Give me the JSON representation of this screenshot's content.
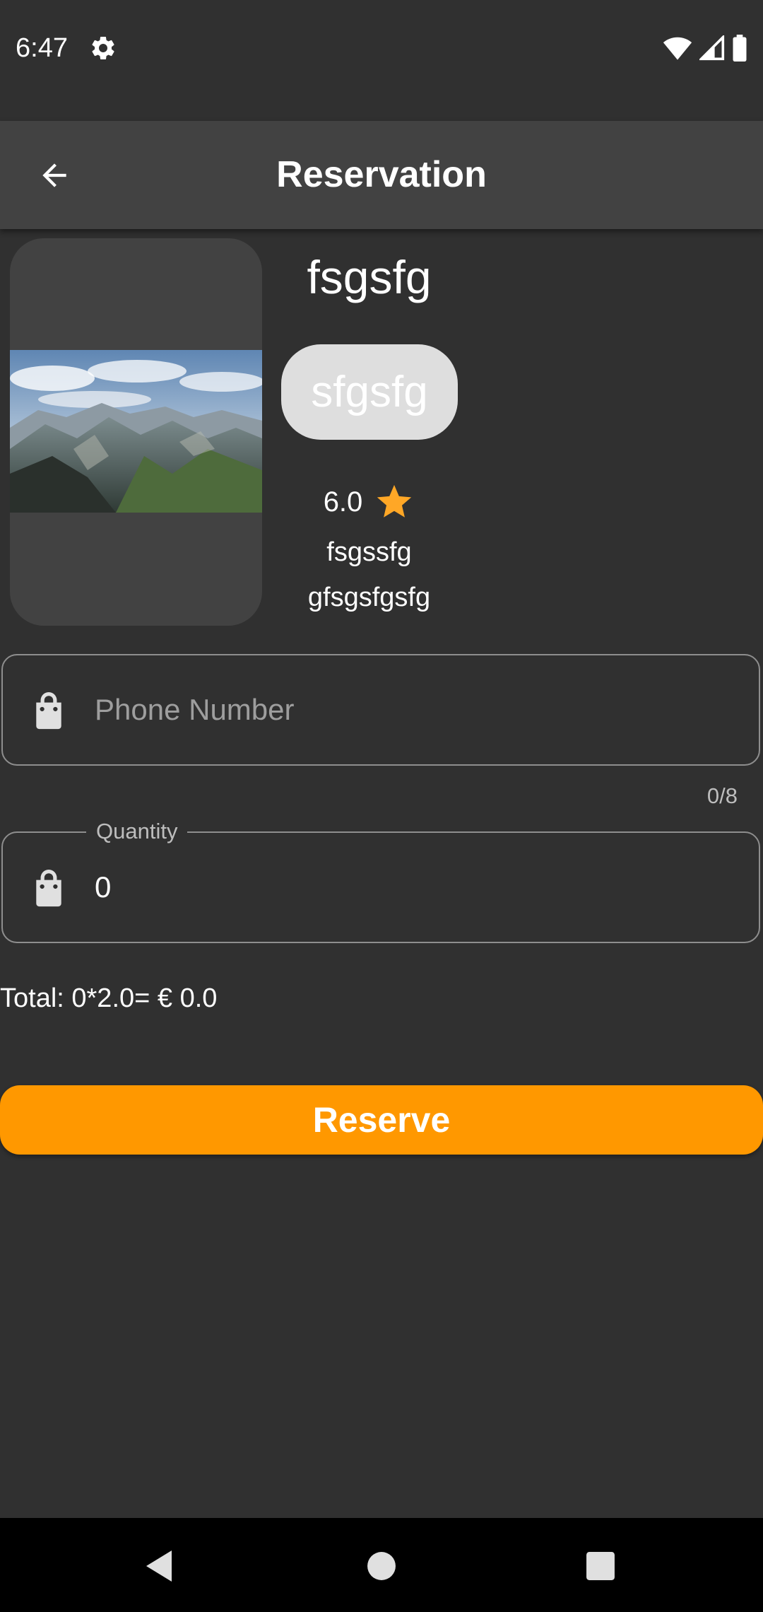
{
  "status_bar": {
    "time": "6:47",
    "icons": [
      "gear-icon",
      "wifi-icon",
      "signal-icon",
      "battery-icon"
    ]
  },
  "app_bar": {
    "title": "Reservation",
    "back_icon": "arrow-back-icon"
  },
  "product": {
    "name": "fsgsfg",
    "category": "sfgsfg",
    "rating": "6.0",
    "description_line1": "fsgssfg",
    "description_line2": "gfsgsfgsfg",
    "image": "mountain-landscape-photo"
  },
  "phone_field": {
    "placeholder": "Phone Number",
    "value": "",
    "counter": "0/8",
    "icon": "shopping-bag-icon"
  },
  "quantity_field": {
    "label": "Quantity",
    "value": "0",
    "icon": "shopping-bag-icon"
  },
  "total": {
    "text": "Total: 0*2.0= € 0.0"
  },
  "reserve_button": {
    "label": "Reserve"
  },
  "nav_bar": {
    "icons": [
      "back-triangle-icon",
      "home-circle-icon",
      "recents-square-icon"
    ]
  },
  "colors": {
    "background": "#303030",
    "app_bar": "#424242",
    "accent": "#ff9800",
    "star": "#ffa726",
    "chip": "#dedede"
  }
}
